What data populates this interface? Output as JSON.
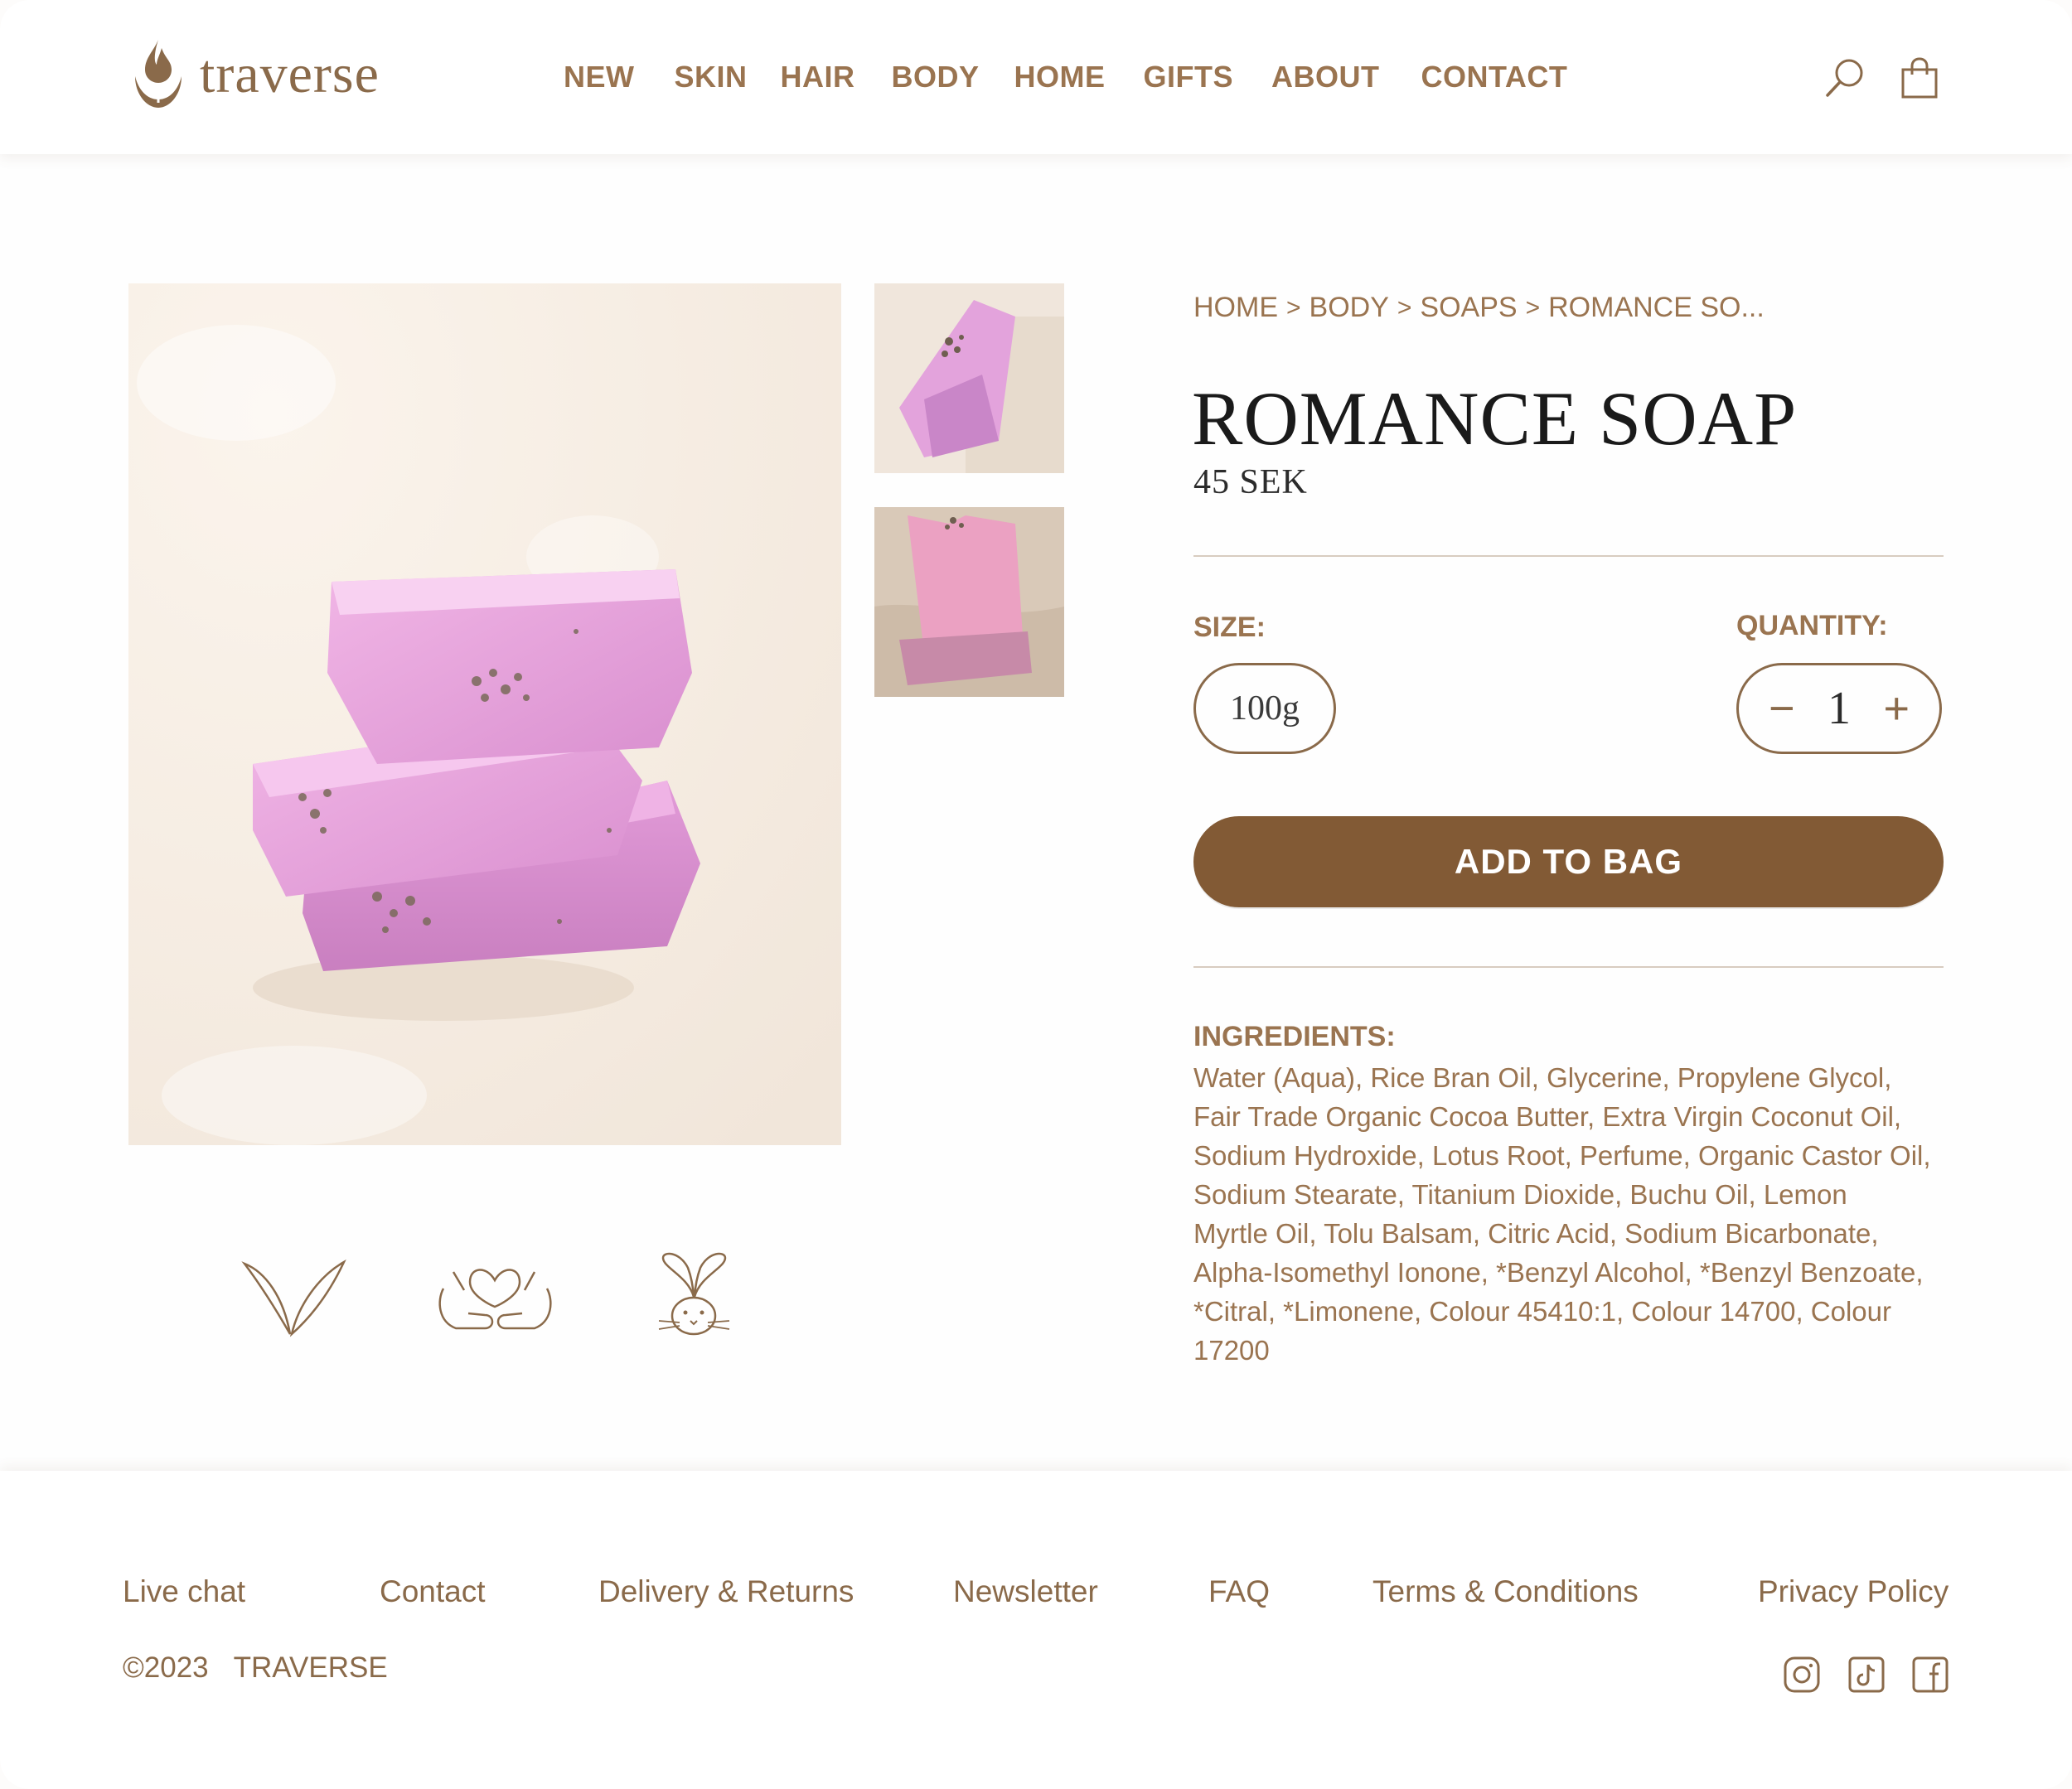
{
  "header": {
    "logo_text": "traverse",
    "nav": [
      "NEW",
      "SKIN",
      "HAIR",
      "BODY",
      "HOME",
      "GIFTS",
      "ABOUT",
      "CONTACT"
    ]
  },
  "product": {
    "breadcrumb": [
      "HOME",
      "BODY",
      "SOAPS",
      "ROMANCE SO..."
    ],
    "breadcrumb_separator": ">",
    "title": "ROMANCE SOAP",
    "price": "45 SEK",
    "size_label": "SIZE:",
    "size_value": "100g",
    "quantity_label": "QUANTITY:",
    "quantity_minus": "−",
    "quantity_value": "1",
    "quantity_plus": "+",
    "add_to_bag": "ADD TO BAG",
    "ingredients_label": "INGREDIENTS:",
    "ingredients_lines": [
      "Water (Aqua), Rice Bran Oil, Glycerine, Propylene Glycol,",
      "Fair Trade Organic Cocoa Butter, Extra Virgin Coconut Oil,",
      "Sodium Hydroxide, Lotus Root, Perfume, Organic Castor Oil,",
      "Sodium Stearate, Titanium Dioxide, Buchu Oil, Lemon",
      "Myrtle Oil, Tolu Balsam, Citric Acid, Sodium Bicarbonate,",
      "Alpha-Isomethyl Ionone, *Benzyl Alcohol, *Benzyl Benzoate,",
      "*Citral, *Limonene, Colour 45410:1, Colour 14700, Colour",
      "17200"
    ]
  },
  "badges": [
    "vegan-leaf-icon",
    "fair-trade-hands-icon",
    "cruelty-free-bunny-icon"
  ],
  "footer": {
    "links": [
      "Live chat",
      "Contact",
      "Delivery & Returns",
      "Newsletter",
      "FAQ",
      "Terms & Conditions",
      "Privacy Policy"
    ],
    "copyright_year": "©2023",
    "copyright_brand": "TRAVERSE",
    "social": [
      "instagram-icon",
      "tiktok-icon",
      "facebook-icon"
    ]
  },
  "colors": {
    "brand": "#825a35",
    "text_accent": "#9a7450",
    "soap_pink": "#d98fcf"
  }
}
